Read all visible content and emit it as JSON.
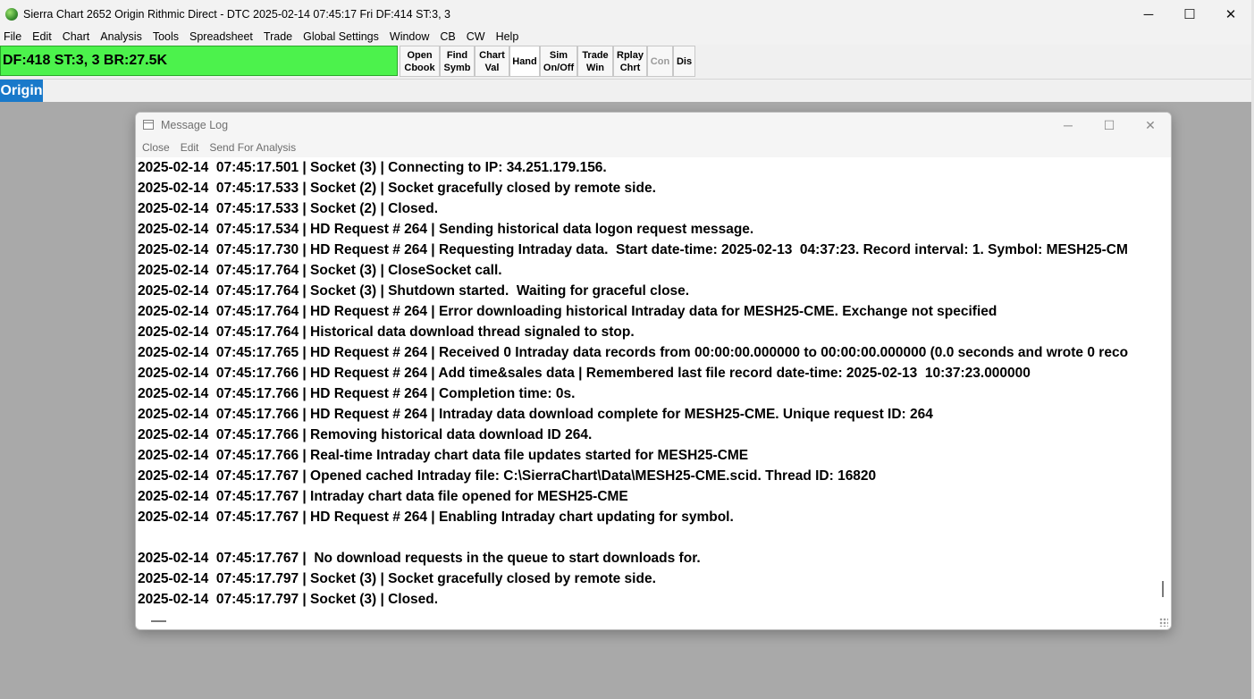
{
  "window": {
    "title": "Sierra Chart 2652 Origin Rithmic Direct - DTC 2025-02-14  07:45:17 Fri DF:414  ST:3, 3",
    "minimize": "─",
    "maximize": "☐",
    "close": "✕"
  },
  "menu": [
    "File",
    "Edit",
    "Chart",
    "Analysis",
    "Tools",
    "Spreadsheet",
    "Trade",
    "Global Settings",
    "Window",
    "CB",
    "CW",
    "Help"
  ],
  "status": {
    "text": "DF:418  ST:3, 3  BR:27.5K",
    "color": "#4cf24c"
  },
  "toolbar": {
    "buttons": [
      {
        "line1": "Open",
        "line2": "Cbook"
      },
      {
        "line1": "Find",
        "line2": "Symb"
      },
      {
        "line1": "Chart",
        "line2": "Val"
      },
      {
        "line1": "Hand",
        "line2": ""
      },
      {
        "line1": "Sim",
        "line2": "On/Off"
      },
      {
        "line1": "Trade",
        "line2": "Win"
      },
      {
        "line1": "Rplay",
        "line2": "Chrt"
      },
      {
        "line1": "Con",
        "line2": ""
      },
      {
        "line1": "Dis",
        "line2": ""
      }
    ]
  },
  "tab": {
    "label": "Origin",
    "color": "#1979ca"
  },
  "message_log": {
    "title": "Message Log",
    "menu": [
      "Close",
      "Edit",
      "Send For Analysis"
    ],
    "lines": [
      "2025-02-14  07:45:17.501 | Socket (3) | Connecting to IP: 34.251.179.156.",
      "2025-02-14  07:45:17.533 | Socket (2) | Socket gracefully closed by remote side.",
      "2025-02-14  07:45:17.533 | Socket (2) | Closed.",
      "2025-02-14  07:45:17.534 | HD Request # 264 | Sending historical data logon request message.",
      "2025-02-14  07:45:17.730 | HD Request # 264 | Requesting Intraday data.  Start date-time: 2025-02-13  04:37:23. Record interval: 1. Symbol: MESH25-CM",
      "2025-02-14  07:45:17.764 | Socket (3) | CloseSocket call.",
      "2025-02-14  07:45:17.764 | Socket (3) | Shutdown started.  Waiting for graceful close.",
      "2025-02-14  07:45:17.764 | HD Request # 264 | Error downloading historical Intraday data for MESH25-CME. Exchange not specified",
      "2025-02-14  07:45:17.764 | Historical data download thread signaled to stop.",
      "2025-02-14  07:45:17.765 | HD Request # 264 | Received 0 Intraday data records from 00:00:00.000000 to 00:00:00.000000 (0.0 seconds and wrote 0 reco",
      "2025-02-14  07:45:17.766 | HD Request # 264 | Add time&sales data | Remembered last file record date-time: 2025-02-13  10:37:23.000000",
      "2025-02-14  07:45:17.766 | HD Request # 264 | Completion time: 0s.",
      "2025-02-14  07:45:17.766 | HD Request # 264 | Intraday data download complete for MESH25-CME. Unique request ID: 264",
      "2025-02-14  07:45:17.766 | Removing historical data download ID 264.",
      "2025-02-14  07:45:17.766 | Real-time Intraday chart data file updates started for MESH25-CME",
      "2025-02-14  07:45:17.767 | Opened cached Intraday file: C:\\SierraChart\\Data\\MESH25-CME.scid. Thread ID: 16820",
      "2025-02-14  07:45:17.767 | Intraday chart data file opened for MESH25-CME",
      "2025-02-14  07:45:17.767 | HD Request # 264 | Enabling Intraday chart updating for symbol.",
      "",
      "2025-02-14  07:45:17.767 |  No download requests in the queue to start downloads for.",
      "2025-02-14  07:45:17.797 | Socket (3) | Socket gracefully closed by remote side.",
      "2025-02-14  07:45:17.797 | Socket (3) | Closed."
    ]
  }
}
